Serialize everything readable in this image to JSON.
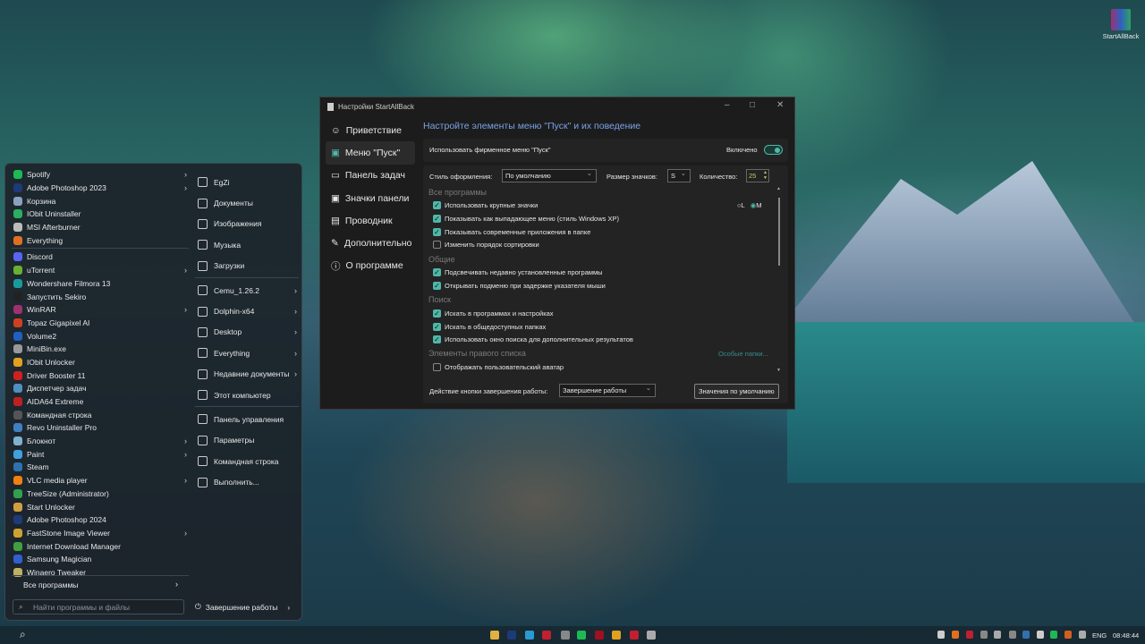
{
  "desktop": {
    "icon_label": "StartAllBack"
  },
  "start_menu": {
    "left_items": [
      {
        "label": "Spotify",
        "color": "#1db954",
        "arrow": true
      },
      {
        "label": "Adobe Photoshop 2023",
        "color": "#1e3a78",
        "arrow": true
      },
      {
        "label": "Корзина",
        "color": "#8aa0c0",
        "arrow": false
      },
      {
        "label": "IObit Uninstaller",
        "color": "#2ab060",
        "arrow": false
      },
      {
        "label": "MSI Afterburner",
        "color": "#bbbbbb",
        "arrow": false
      },
      {
        "label": "Everything",
        "color": "#e07020",
        "arrow": false,
        "sep": true
      },
      {
        "label": "Discord",
        "color": "#5865f2",
        "arrow": false
      },
      {
        "label": "uTorrent",
        "color": "#6ab030",
        "arrow": true
      },
      {
        "label": "Wondershare Filmora 13",
        "color": "#1a9a9a",
        "arrow": false
      },
      {
        "label": "Запустить Sekiro",
        "color": "#222222",
        "arrow": false
      },
      {
        "label": "WinRAR",
        "color": "#a03070",
        "arrow": true
      },
      {
        "label": "Topaz Gigapixel AI",
        "color": "#d04020",
        "arrow": false
      },
      {
        "label": "Volume2",
        "color": "#2060c0",
        "arrow": false
      },
      {
        "label": "MiniBin.exe",
        "color": "#999999",
        "arrow": false
      },
      {
        "label": "IObit Unlocker",
        "color": "#e0a020",
        "arrow": false
      },
      {
        "label": "Driver Booster 11",
        "color": "#d02020",
        "arrow": false
      },
      {
        "label": "Диспетчер задач",
        "color": "#5090c0",
        "arrow": false
      },
      {
        "label": "AIDA64 Extreme",
        "color": "#c02020",
        "arrow": false
      },
      {
        "label": "Командная строка",
        "color": "#555555",
        "arrow": false
      },
      {
        "label": "Revo Uninstaller Pro",
        "color": "#4080c0",
        "arrow": false
      },
      {
        "label": "Блокнот",
        "color": "#80b0d0",
        "arrow": true
      },
      {
        "label": "Paint",
        "color": "#40a0e0",
        "arrow": true
      },
      {
        "label": "Steam",
        "color": "#3070b0",
        "arrow": false
      },
      {
        "label": "VLC media player",
        "color": "#f08010",
        "arrow": true
      },
      {
        "label": "TreeSize (Administrator)",
        "color": "#30a050",
        "arrow": false
      },
      {
        "label": "Start Unlocker",
        "color": "#d0a040",
        "arrow": false
      },
      {
        "label": "Adobe Photoshop 2024",
        "color": "#1e3a78",
        "arrow": false
      },
      {
        "label": "FastStone Image Viewer",
        "color": "#d0a030",
        "arrow": true
      },
      {
        "label": "Internet Download Manager",
        "color": "#40a040",
        "arrow": false
      },
      {
        "label": "Samsung Magician",
        "color": "#3060d0",
        "arrow": false
      },
      {
        "label": "Winaero Tweaker",
        "color": "#c0b060",
        "arrow": false
      }
    ],
    "all_programs": "Все программы",
    "right_items": [
      {
        "label": "EgZi",
        "icon": "user-folder-icon",
        "arrow": false
      },
      {
        "label": "Документы",
        "icon": "document-icon",
        "arrow": false
      },
      {
        "label": "Изображения",
        "icon": "image-icon",
        "arrow": false
      },
      {
        "label": "Музыка",
        "icon": "music-icon",
        "arrow": false
      },
      {
        "label": "Загрузки",
        "icon": "download-icon",
        "arrow": false,
        "sep": true
      },
      {
        "label": "Cemu_1.26.2",
        "icon": "folder-icon",
        "arrow": true
      },
      {
        "label": "Dolphin-x64",
        "icon": "folder-icon",
        "arrow": true
      },
      {
        "label": "Desktop",
        "icon": "folder-icon",
        "arrow": true
      },
      {
        "label": "Everything",
        "icon": "search-icon",
        "arrow": true
      },
      {
        "label": "Недавние документы",
        "icon": "clock-icon",
        "arrow": true
      },
      {
        "label": "Этот компьютер",
        "icon": "computer-icon",
        "arrow": false,
        "sep": true
      },
      {
        "label": "Панель управления",
        "icon": "control-panel-icon",
        "arrow": false
      },
      {
        "label": "Параметры",
        "icon": "gear-icon",
        "arrow": false
      },
      {
        "label": "Командная строка",
        "icon": "terminal-icon",
        "arrow": false
      },
      {
        "label": "Выполнить...",
        "icon": "run-icon",
        "arrow": false
      }
    ],
    "search_placeholder": "Найти программы и файлы",
    "power_label": "Завершение работы"
  },
  "settings": {
    "title": "Настройки StartAllBack",
    "nav": [
      {
        "label": "Приветствие",
        "icon": "☺"
      },
      {
        "label": "Меню \"Пуск\"",
        "icon": "▣",
        "active": true
      },
      {
        "label": "Панель задач",
        "icon": "▭"
      },
      {
        "label": "Значки панели",
        "icon": "▣"
      },
      {
        "label": "Проводник",
        "icon": "▤"
      },
      {
        "label": "Дополнительно",
        "icon": "✎"
      },
      {
        "label": "О программе",
        "icon": "ⓘ"
      }
    ],
    "heading": "Настройте элементы меню \"Пуск\" и их поведение",
    "use_custom_menu": "Использовать фирменное меню \"Пуск\"",
    "enabled_label": "Включено",
    "style_label": "Стиль оформления:",
    "style_value": "По умолчанию",
    "icon_size_label": "Размер значков:",
    "icon_size_value": "S",
    "count_label": "Количество:",
    "count_value": "25",
    "groups": {
      "all": "Все программы",
      "general": "Общие",
      "search": "Поиск",
      "right": "Элементы правого списка"
    },
    "radio_l": "L",
    "radio_m": "M",
    "special_folders": "Особые папки...",
    "checks": [
      {
        "label": "Использовать крупные значки",
        "checked": true
      },
      {
        "label": "Показывать как выпадающее меню (стиль Windows XP)",
        "checked": true
      },
      {
        "label": "Показывать современные приложения в папке",
        "checked": true
      },
      {
        "label": "Изменить порядок сортировки",
        "checked": false
      },
      {
        "label": "Подсвечивать недавно установленные программы",
        "checked": true
      },
      {
        "label": "Открывать подменю при задержке указателя мыши",
        "checked": true
      },
      {
        "label": "Искать в программах и настройках",
        "checked": true
      },
      {
        "label": "Искать в общедоступных папках",
        "checked": true
      },
      {
        "label": "Использовать окно поиска для дополнительных результатов",
        "checked": true
      },
      {
        "label": "Отображать пользовательский аватар",
        "checked": false
      }
    ],
    "power_action_label": "Действие кнопки завершения работы:",
    "power_action_value": "Завершение работы",
    "defaults_button": "Значения по умолчанию"
  },
  "taskbar": {
    "lang": "ENG",
    "time": "08:48:44"
  }
}
